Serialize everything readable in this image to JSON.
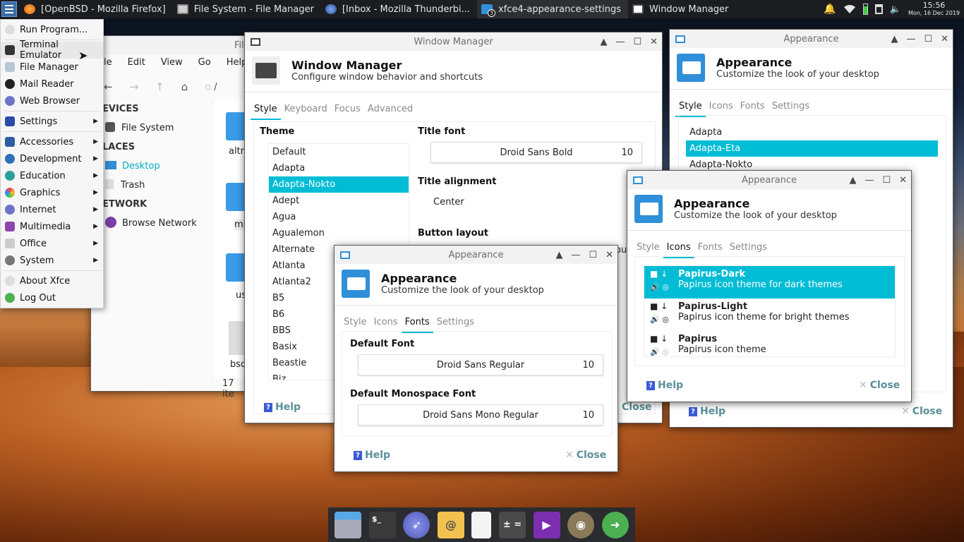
{
  "panel": {
    "tasks": [
      {
        "label": "[OpenBSD - Mozilla Firefox]",
        "icon": "firefox-icon"
      },
      {
        "label": "File System - File Manager",
        "icon": "file-manager-icon"
      },
      {
        "label": "[Inbox - Mozilla Thunderbi...",
        "icon": "thunderbird-icon"
      },
      {
        "label": "xfce4-appearance-settings",
        "icon": "appearance-icon",
        "badge": "3"
      },
      {
        "label": "Window Manager",
        "icon": "window-manager-icon"
      }
    ],
    "clock_time": "15:56",
    "clock_date": "Mon, 16 Dec 2019"
  },
  "menu": {
    "items": [
      {
        "label": "Run Program..."
      },
      {
        "label": "Terminal Emulator"
      },
      {
        "label": "File Manager"
      },
      {
        "label": "Mail Reader"
      },
      {
        "label": "Web Browser"
      },
      {
        "label": "Settings"
      },
      {
        "label": "Accessories"
      },
      {
        "label": "Development"
      },
      {
        "label": "Education"
      },
      {
        "label": "Graphics"
      },
      {
        "label": "Internet"
      },
      {
        "label": "Multimedia"
      },
      {
        "label": "Office"
      },
      {
        "label": "System"
      },
      {
        "label": "About Xfce"
      },
      {
        "label": "Log Out"
      }
    ]
  },
  "filemanager": {
    "title": "Fil",
    "menubar": [
      "le",
      "Edit",
      "View",
      "Go",
      "Help"
    ],
    "path": "/",
    "sections": {
      "devices": "EVICES",
      "places": "LACES",
      "network": "ETWORK"
    },
    "items": {
      "filesystem": "File System",
      "desktop": "Desktop",
      "trash": "Trash",
      "browse": "Browse Network"
    },
    "folders": [
      "altr",
      "mn",
      "us",
      "bsd"
    ],
    "status": "17 ite"
  },
  "wm": {
    "title": "Window Manager",
    "header_title": "Window Manager",
    "header_sub": "Configure window behavior and shortcuts",
    "tabs": [
      "Style",
      "Keyboard",
      "Focus",
      "Advanced"
    ],
    "theme_label": "Theme",
    "themes": [
      "Default",
      "Adapta",
      "Adapta-Nokto",
      "Adept",
      "Agua",
      "Agualemon",
      "Alternate",
      "Atlanta",
      "Atlanta2",
      "B5",
      "B6",
      "BBS",
      "Basix",
      "Beastie",
      "Biz"
    ],
    "title_font_label": "Title font",
    "title_font": "Droid Sans Bold",
    "title_font_size": "10",
    "title_align_label": "Title alignment",
    "title_align": "Center",
    "button_layout_label": "Button layout",
    "clipped_text": "ou",
    "help": "Help",
    "close": "Close"
  },
  "app1": {
    "title": "Appearance",
    "header_title": "Appearance",
    "header_sub": "Customize the look of your desktop",
    "tabs": [
      "Style",
      "Icons",
      "Fonts",
      "Settings"
    ],
    "styles": [
      "Adapta",
      "Adapta-Eta",
      "Adapta-Nokto"
    ],
    "help": "Help",
    "close": "Close"
  },
  "app2": {
    "title": "Appearance",
    "header_title": "Appearance",
    "header_sub": "Customize the look of your desktop",
    "tabs": [
      "Style",
      "Icons",
      "Fonts",
      "Settings"
    ],
    "icon_themes": [
      {
        "name": "Papirus-Dark",
        "desc": "Papirus icon theme for dark themes"
      },
      {
        "name": "Papirus-Light",
        "desc": "Papirus icon theme for bright themes"
      },
      {
        "name": "Papirus",
        "desc": "Papirus icon theme"
      }
    ],
    "help": "Help",
    "close": "Close"
  },
  "app3": {
    "title": "Appearance",
    "header_title": "Appearance",
    "header_sub": "Customize the look of your desktop",
    "tabs": [
      "Style",
      "Icons",
      "Fonts",
      "Settings"
    ],
    "default_font_label": "Default Font",
    "default_font": "Droid Sans Regular",
    "default_font_size": "10",
    "mono_font_label": "Default Monospace Font",
    "mono_font": "Droid Sans Mono Regular",
    "mono_font_size": "10",
    "help": "Help",
    "close": "Close"
  },
  "colors": {
    "accent": "#00bcd4",
    "panel": "#1c1d20"
  }
}
